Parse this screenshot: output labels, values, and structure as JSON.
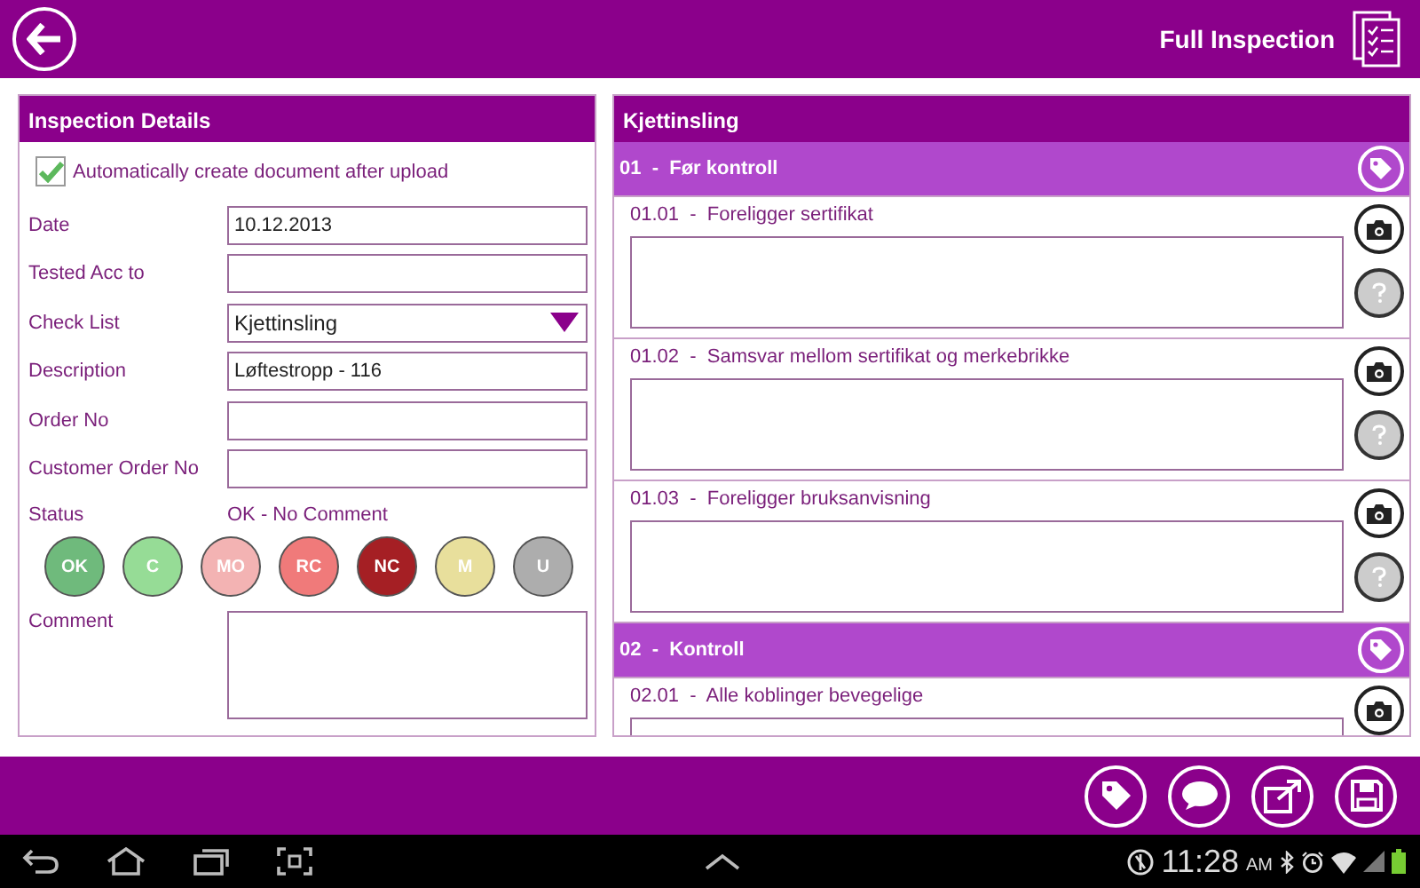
{
  "header": {
    "title": "Full Inspection"
  },
  "details": {
    "title": "Inspection Details",
    "auto_document": {
      "label": "Automatically create document after upload",
      "checked": true
    },
    "fields": [
      {
        "label": "Date",
        "kind": "text",
        "value": "10.12.2013"
      },
      {
        "label": "Tested Acc to",
        "kind": "text"
      },
      {
        "label": "Check List",
        "kind": "dropdown",
        "value": "Kjettinsling"
      },
      {
        "label": "Description",
        "kind": "text",
        "value": "Løftestropp - 116"
      },
      {
        "label": "Order No",
        "kind": "text"
      },
      {
        "label": "Customer Order No",
        "kind": "text"
      }
    ],
    "status": {
      "label": "Status",
      "value": "OK - No Comment",
      "options": [
        {
          "label": "OK",
          "color": "#6fba7c"
        },
        {
          "label": "C",
          "color": "#96dc96"
        },
        {
          "label": "MO",
          "color": "#f3b3b3"
        },
        {
          "label": "RC",
          "color": "#f07a7a"
        },
        {
          "label": "NC",
          "color": "#a51f24"
        },
        {
          "label": "M",
          "color": "#e8df9c"
        },
        {
          "label": "U",
          "color": "#adadad"
        }
      ]
    },
    "comment": {
      "label": "Comment"
    }
  },
  "checklist": {
    "title": "Kjettinsling",
    "sections": [
      {
        "title": "01  -  Før kontroll",
        "items": [
          "01.01  -  Foreligger sertifikat",
          "01.02  -  Samsvar mellom sertifikat og merkebrikke",
          "01.03  -  Foreligger bruksanvisning"
        ]
      },
      {
        "title": "02  -  Kontroll",
        "items": [
          "02.01  -  Alle koblinger bevegelige"
        ]
      }
    ]
  },
  "statusbar": {
    "time": "11:28",
    "ampm": "AM"
  }
}
